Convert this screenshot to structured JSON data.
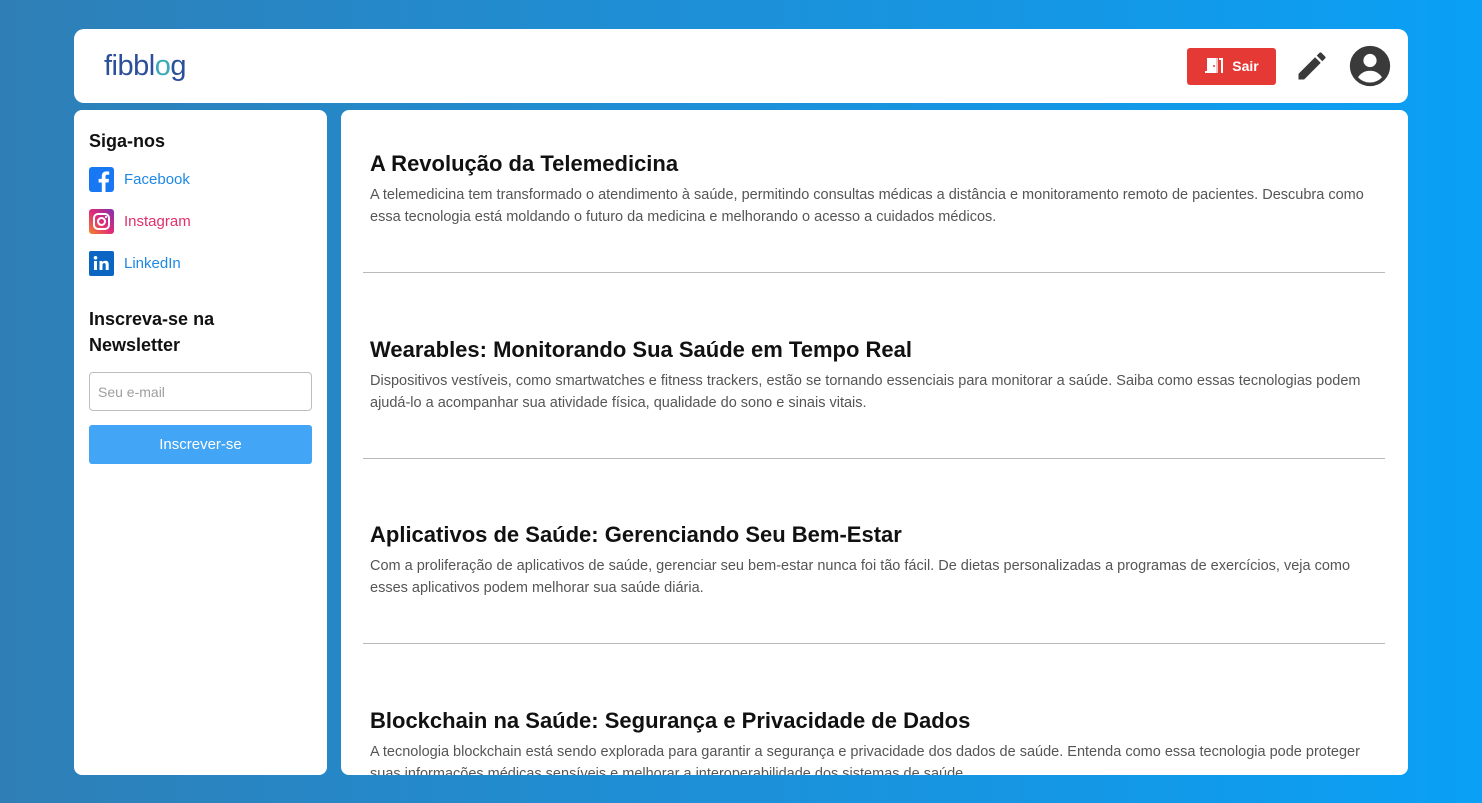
{
  "header": {
    "logo_prefix": "fibbl",
    "logo_o": "o",
    "logo_suffix": "g",
    "logout_label": "Sair"
  },
  "sidebar": {
    "follow_title": "Siga-nos",
    "social": [
      {
        "label": "Facebook",
        "icon": "facebook-icon",
        "color": "#1e88e5"
      },
      {
        "label": "Instagram",
        "icon": "instagram-icon",
        "color": "#e1306c"
      },
      {
        "label": "LinkedIn",
        "icon": "linkedin-icon",
        "color": "#0a66c2"
      }
    ],
    "newsletter_title_line1": "Inscreva-se na",
    "newsletter_title_line2": "Newsletter",
    "email_placeholder": "Seu e-mail",
    "subscribe_label": "Inscrever-se"
  },
  "posts": [
    {
      "title": "A Revolução da Telemedicina",
      "excerpt": "A telemedicina tem transformado o atendimento à saúde, permitindo consultas médicas a distância e monitoramento remoto de pacientes. Descubra como essa tecnologia está moldando o futuro da medicina e melhorando o acesso a cuidados médicos."
    },
    {
      "title": "Wearables: Monitorando Sua Saúde em Tempo Real",
      "excerpt": "Dispositivos vestíveis, como smartwatches e fitness trackers, estão se tornando essenciais para monitorar a saúde. Saiba como essas tecnologias podem ajudá-lo a acompanhar sua atividade física, qualidade do sono e sinais vitais."
    },
    {
      "title": "Aplicativos de Saúde: Gerenciando Seu Bem-Estar",
      "excerpt": "Com a proliferação de aplicativos de saúde, gerenciar seu bem-estar nunca foi tão fácil. De dietas personalizadas a programas de exercícios, veja como esses aplicativos podem melhorar sua saúde diária."
    },
    {
      "title": "Blockchain na Saúde: Segurança e Privacidade de Dados",
      "excerpt": "A tecnologia blockchain está sendo explorada para garantir a segurança e privacidade dos dados de saúde. Entenda como essa tecnologia pode proteger suas informações médicas sensíveis e melhorar a interoperabilidade dos sistemas de saúde."
    }
  ],
  "colors": {
    "accent": "#42a5f5",
    "logout": "#e53935",
    "brand": "#2c4f9b"
  }
}
